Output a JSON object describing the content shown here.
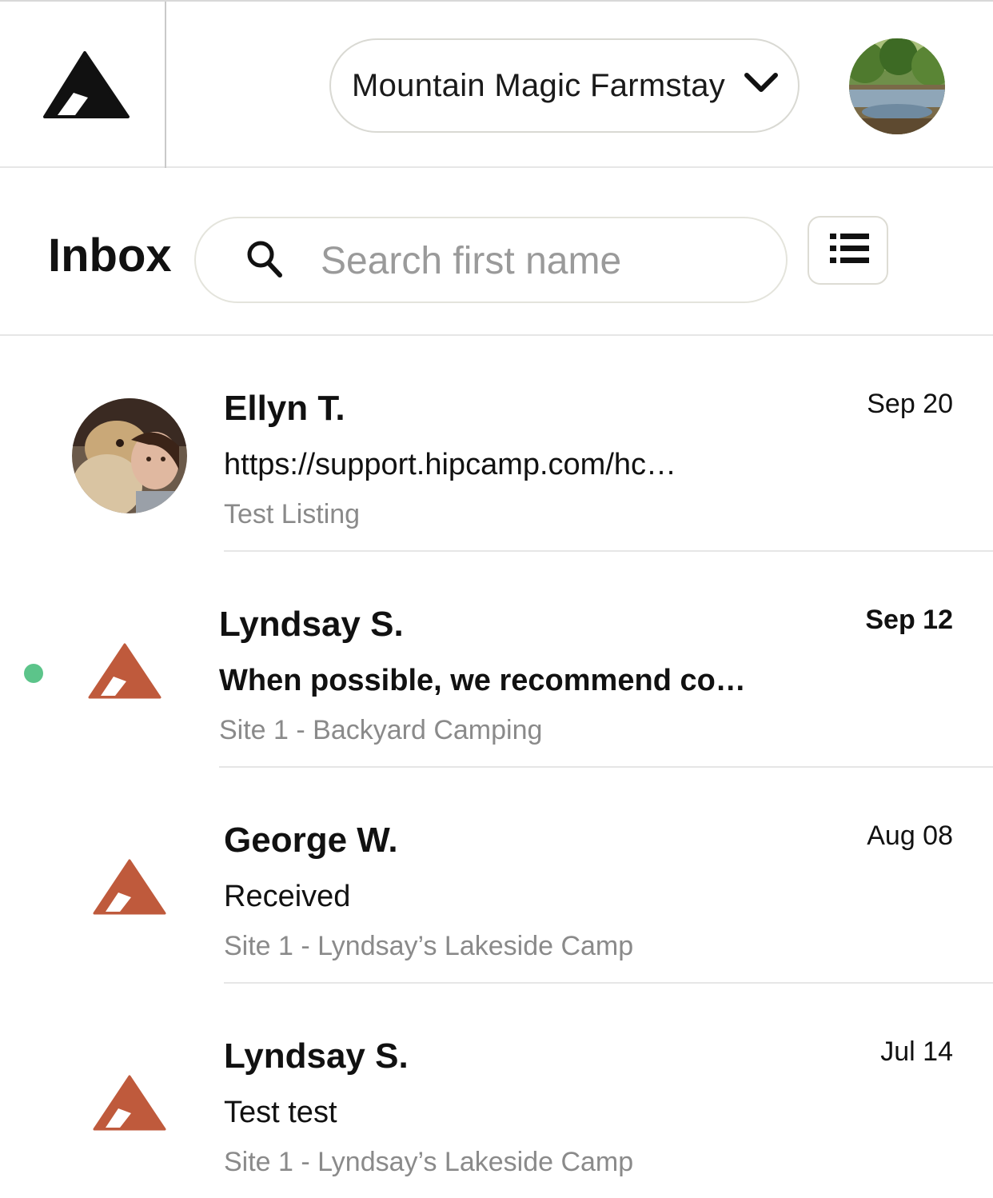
{
  "header": {
    "property_name": "Mountain Magic Farmstay",
    "brand_color": "#111111"
  },
  "inbox": {
    "title": "Inbox",
    "search_placeholder": "Search first name"
  },
  "colors": {
    "tent_accent": "#BF5A3C",
    "unread_dot": "#5CC48A",
    "muted_text": "#8A8A8A"
  },
  "conversations": [
    {
      "name": "Ellyn T.",
      "preview": "https://support.hipcamp.com/hc…",
      "listing": "Test Listing",
      "date": "Sep 20",
      "unread": false,
      "avatar": "photo"
    },
    {
      "name": "Lyndsay S.",
      "preview": "When possible, we recommend co…",
      "listing": "Site 1 - Backyard Camping",
      "date": "Sep 12",
      "unread": true,
      "avatar": "tent-icon"
    },
    {
      "name": "George W.",
      "preview": "Received",
      "listing": "Site 1 - Lyndsay’s Lakeside Camp",
      "date": "Aug 08",
      "unread": false,
      "avatar": "tent-icon"
    },
    {
      "name": "Lyndsay S.",
      "preview": "Test test",
      "listing": "Site 1 - Lyndsay’s Lakeside Camp",
      "date": "Jul 14",
      "unread": false,
      "avatar": "tent-icon"
    }
  ]
}
